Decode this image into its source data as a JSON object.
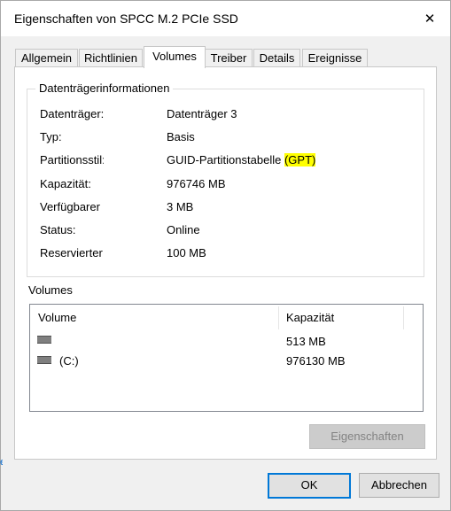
{
  "window": {
    "title": "Eigenschaften von SPCC M.2 PCIe SSD",
    "close_glyph": "✕"
  },
  "tabs": [
    {
      "label": "Allgemein",
      "active": false
    },
    {
      "label": "Richtlinien",
      "active": false
    },
    {
      "label": "Volumes",
      "active": true
    },
    {
      "label": "Treiber",
      "active": false
    },
    {
      "label": "Details",
      "active": false
    },
    {
      "label": "Ereignisse",
      "active": false
    }
  ],
  "disk_info": {
    "group_title": "Datenträgerinformationen",
    "rows": [
      {
        "label": "Datenträger:",
        "value": "Datenträger 3"
      },
      {
        "label": "Typ:",
        "value": "Basis"
      },
      {
        "label": "Partitionsstil:",
        "value": "GUID-Partitionstabelle ",
        "highlight": "(GPT)"
      },
      {
        "label": "Kapazität:",
        "value": "976746 MB"
      },
      {
        "label": "Verfügbarer Speicher:",
        "value": "3 MB"
      },
      {
        "label": "Status:",
        "value": "Online"
      },
      {
        "label": "Reservierter Speicher:",
        "value": "100 MB"
      }
    ]
  },
  "volumes": {
    "title": "Volumes",
    "columns": [
      "Volume",
      "Kapazität"
    ],
    "rows": [
      {
        "volume": "",
        "icon": "drive-icon",
        "capacity": "513 MB"
      },
      {
        "volume": "(C:)",
        "icon": "drive-icon",
        "capacity": "976130 MB"
      }
    ]
  },
  "buttons": {
    "properties": "Eigenschaften",
    "ok": "OK",
    "cancel": "Abbrechen"
  },
  "background_fragment": "e"
}
